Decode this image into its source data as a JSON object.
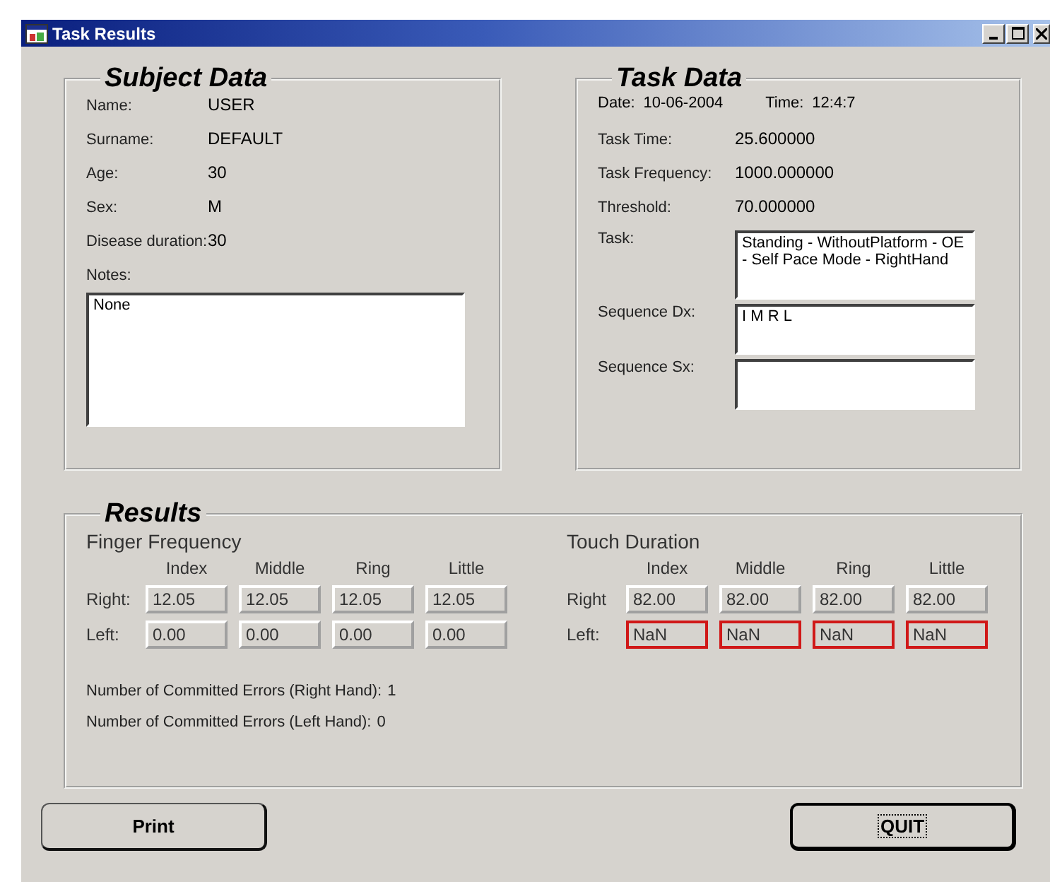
{
  "window": {
    "title": "Task Results"
  },
  "subject_data": {
    "title": "Subject Data",
    "fields": [
      {
        "label": "Name:",
        "value": "USER"
      },
      {
        "label": "Surname:",
        "value": "DEFAULT"
      },
      {
        "label": "Age:",
        "value": "30"
      },
      {
        "label": "Sex:",
        "value": "M"
      },
      {
        "label": "Disease duration:",
        "value": "30"
      }
    ],
    "notes": {
      "label": "Notes:",
      "value": "None"
    }
  },
  "task_data": {
    "title": "Task Data",
    "date": {
      "label": "Date:",
      "value": "10-06-2004"
    },
    "time": {
      "label": "Time:",
      "value": "12:4:7"
    },
    "fields": [
      {
        "label": "Task Time:",
        "value": "25.600000"
      },
      {
        "label": "Task Frequency:",
        "value": "1000.000000"
      },
      {
        "label": "Threshold:",
        "value": "70.000000"
      }
    ],
    "task": {
      "label": "Task:",
      "value": "Standing - WithoutPlatform - OE - Self Pace Mode - RightHand"
    },
    "sequence_dx": {
      "label": "Sequence Dx:",
      "value": "I M R L"
    },
    "sequence_sx": {
      "label": "Sequence Sx:"
    }
  },
  "results": {
    "title": "Results",
    "groups": [
      {
        "title": "Finger Frequency",
        "columns": [
          "Index",
          "Middle",
          "Ring",
          "Little"
        ],
        "rows": [
          {
            "label": "Right:",
            "cells": [
              {
                "value": "12.05",
                "flagged": false
              },
              {
                "value": "12.05",
                "flagged": false
              },
              {
                "value": "12.05",
                "flagged": false
              },
              {
                "value": "12.05",
                "flagged": false
              }
            ]
          },
          {
            "label": "Left:",
            "cells": [
              {
                "value": "0.00",
                "flagged": false
              },
              {
                "value": "0.00",
                "flagged": false
              },
              {
                "value": "0.00",
                "flagged": false
              },
              {
                "value": "0.00",
                "flagged": false
              }
            ]
          }
        ]
      },
      {
        "title": "Touch Duration",
        "columns": [
          "Index",
          "Middle",
          "Ring",
          "Little"
        ],
        "rows": [
          {
            "label": "Right",
            "cells": [
              {
                "value": "82.00",
                "flagged": false
              },
              {
                "value": "82.00",
                "flagged": false
              },
              {
                "value": "82.00",
                "flagged": false
              },
              {
                "value": "82.00",
                "flagged": false
              }
            ]
          },
          {
            "label": "Left:",
            "cells": [
              {
                "value": "NaN",
                "flagged": true
              },
              {
                "value": "NaN",
                "flagged": true
              },
              {
                "value": "NaN",
                "flagged": true
              },
              {
                "value": "NaN",
                "flagged": true
              }
            ]
          }
        ]
      }
    ],
    "errors": [
      {
        "label": "Number of Committed Errors (Right Hand):",
        "value": "1"
      },
      {
        "label": "Number of Committed Errors (Left Hand):",
        "value": "0"
      }
    ]
  },
  "buttons": [
    {
      "label": "Print",
      "focused": false
    },
    {
      "label": "QUIT",
      "focused": true
    }
  ]
}
